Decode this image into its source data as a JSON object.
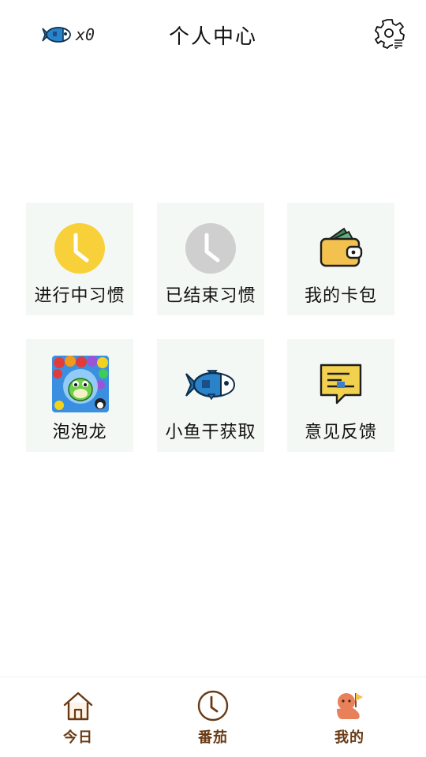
{
  "header": {
    "fish_count": "x0",
    "title": "个人中心"
  },
  "tiles": [
    {
      "label": "进行中习惯",
      "icon": "clock-yellow-icon"
    },
    {
      "label": "已结束习惯",
      "icon": "clock-gray-icon"
    },
    {
      "label": "我的卡包",
      "icon": "wallet-icon"
    },
    {
      "label": "泡泡龙",
      "icon": "bubble-dragon-game-icon"
    },
    {
      "label": "小鱼干获取",
      "icon": "fish-icon"
    },
    {
      "label": "意见反馈",
      "icon": "feedback-icon"
    }
  ],
  "nav": {
    "items": [
      {
        "label": "今日",
        "icon": "house-icon"
      },
      {
        "label": "番茄",
        "icon": "clock-icon"
      },
      {
        "label": "我的",
        "icon": "octopus-icon"
      }
    ]
  },
  "colors": {
    "tile_bg": "#f4f8f4",
    "accent_yellow": "#f8d13a",
    "inactive_gray": "#cfcfcf",
    "nav_brown": "#6a3a14",
    "profile_orange": "#e8805a"
  }
}
